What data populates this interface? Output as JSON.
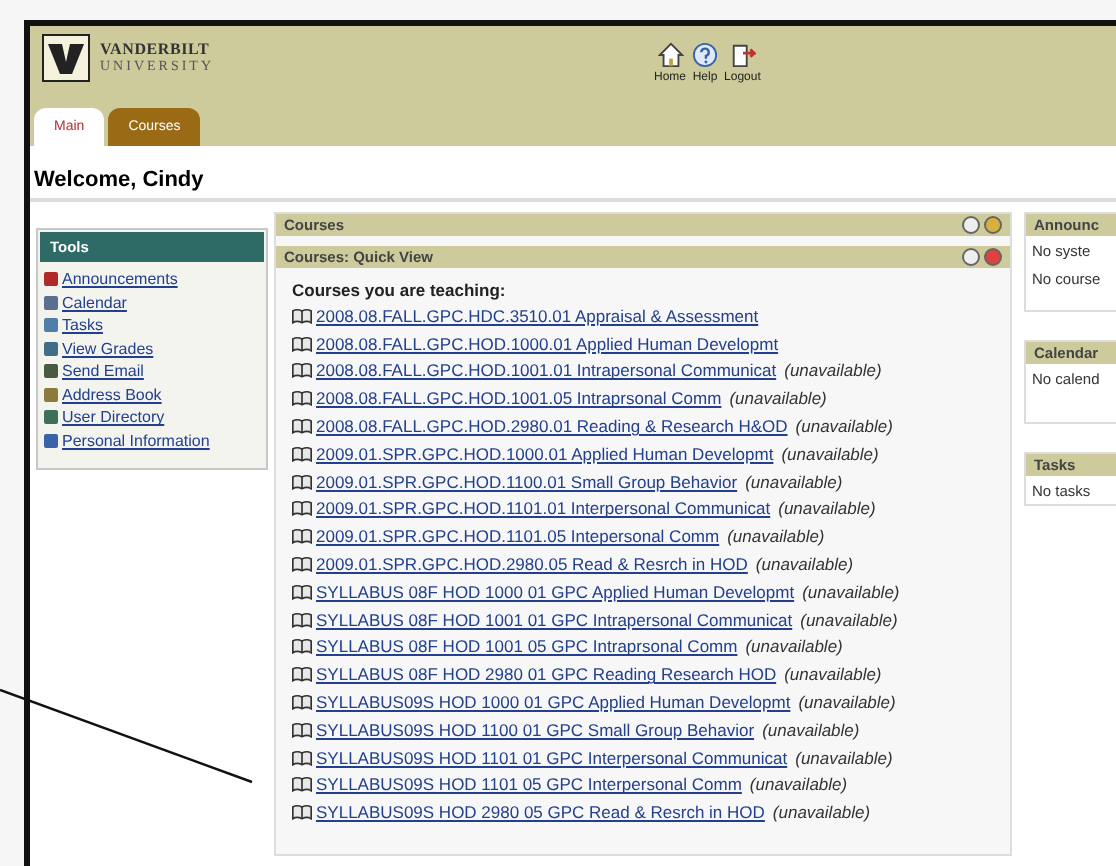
{
  "logo": {
    "line1": "VANDERBILT",
    "line2": "UNIVERSITY"
  },
  "header_links": [
    {
      "kind": "home",
      "label": "Home"
    },
    {
      "kind": "help",
      "label": "Help"
    },
    {
      "kind": "logout",
      "label": "Logout"
    }
  ],
  "tabs": [
    {
      "label": "Main",
      "selected": true
    },
    {
      "label": "Courses",
      "selected": false
    }
  ],
  "welcome": "Welcome, Cindy",
  "tools": {
    "title": "Tools",
    "items": [
      {
        "label": "Announcements",
        "color": "#b02a2a"
      },
      {
        "label": "Calendar",
        "color": "#5a6f8f"
      },
      {
        "label": "Tasks",
        "color": "#4f7fa8"
      },
      {
        "label": "View Grades",
        "color": "#3f6f86"
      },
      {
        "label": "Send Email",
        "color": "#4a5a40"
      },
      {
        "label": "Address Book",
        "color": "#8c7a3a"
      },
      {
        "label": "User Directory",
        "color": "#3d6f5a"
      },
      {
        "label": "Personal Information",
        "color": "#3a62a8"
      }
    ]
  },
  "courses": {
    "title": "Courses",
    "quick_view": "Courses: Quick View",
    "heading": "Courses you are teaching:",
    "items": [
      {
        "label": "2008.08.FALL.GPC.HDC.3510.01 Appraisal & Assessment"
      },
      {
        "label": "2008.08.FALL.GPC.HOD.1000.01 Applied Human Developmt"
      },
      {
        "label": "2008.08.FALL.GPC.HOD.1001.01 Intrapersonal Communicat",
        "note": "(unavailable)"
      },
      {
        "label": "2008.08.FALL.GPC.HOD.1001.05 Intraprsonal Comm",
        "note": "(unavailable)"
      },
      {
        "label": "2008.08.FALL.GPC.HOD.2980.01 Reading & Research H&OD",
        "note": "(unavailable)"
      },
      {
        "label": "2009.01.SPR.GPC.HOD.1000.01 Applied Human Developmt",
        "note": "(unavailable)"
      },
      {
        "label": "2009.01.SPR.GPC.HOD.1100.01 Small Group Behavior",
        "note": "(unavailable)"
      },
      {
        "label": "2009.01.SPR.GPC.HOD.1101.01 Interpersonal Communicat",
        "note": "(unavailable)"
      },
      {
        "label": "2009.01.SPR.GPC.HOD.1101.05 Intepersonal Comm",
        "note": "(unavailable)"
      },
      {
        "label": "2009.01.SPR.GPC.HOD.2980.05 Read & Resrch in HOD",
        "note": "(unavailable)"
      },
      {
        "label": "SYLLABUS 08F HOD 1000 01 GPC Applied Human Developmt",
        "note": "(unavailable)"
      },
      {
        "label": "SYLLABUS 08F HOD 1001 01 GPC Intrapersonal Communicat",
        "note": "(unavailable)"
      },
      {
        "label": "SYLLABUS 08F HOD 1001 05 GPC Intraprsonal Comm",
        "note": "(unavailable)"
      },
      {
        "label": "SYLLABUS 08F HOD 2980 01 GPC Reading Research HOD",
        "note": "(unavailable)"
      },
      {
        "label": "SYLLABUS09S HOD 1000 01 GPC Applied Human Developmt",
        "note": "(unavailable)"
      },
      {
        "label": "SYLLABUS09S HOD 1100 01 GPC Small Group Behavior",
        "note": "(unavailable)"
      },
      {
        "label": "SYLLABUS09S HOD 1101 01 GPC Interpersonal Communicat",
        "note": "(unavailable)"
      },
      {
        "label": "SYLLABUS09S HOD 1101 05 GPC Interpersonal Comm",
        "note": "(unavailable)"
      },
      {
        "label": "SYLLABUS09S HOD 2980 05 GPC Read & Resrch in HOD",
        "note": "(unavailable)"
      }
    ]
  },
  "side_panels": [
    {
      "title": "Announc",
      "lines": [
        "No syste",
        "No course"
      ]
    },
    {
      "title": "Calendar",
      "lines": [
        "No calend"
      ]
    },
    {
      "title": "Tasks",
      "lines": [
        "No tasks"
      ]
    }
  ]
}
